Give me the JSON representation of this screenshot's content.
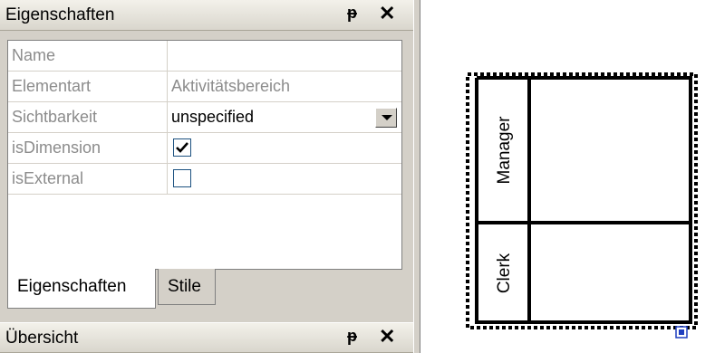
{
  "properties_panel": {
    "title": "Eigenschaften",
    "pin_glyph": "ᵽ",
    "close_glyph": "✕",
    "rows": [
      {
        "name": "Name",
        "value": ""
      },
      {
        "name": "Elementart",
        "value": "Aktivitätsbereich"
      },
      {
        "name": "Sichtbarkeit",
        "value": "unspecified"
      },
      {
        "name": "isDimension",
        "checked": true
      },
      {
        "name": "isExternal",
        "checked": false
      }
    ],
    "tabs": [
      "Eigenschaften",
      "Stile"
    ],
    "active_tab": "Eigenschaften"
  },
  "overview_panel": {
    "title": "Übersicht",
    "pin_glyph": "ᵽ",
    "close_glyph": "✕"
  },
  "diagram": {
    "partitions": [
      "Manager",
      "Clerk"
    ],
    "selection_color": "#000000",
    "handle_icon": "resize-handle-icon"
  }
}
